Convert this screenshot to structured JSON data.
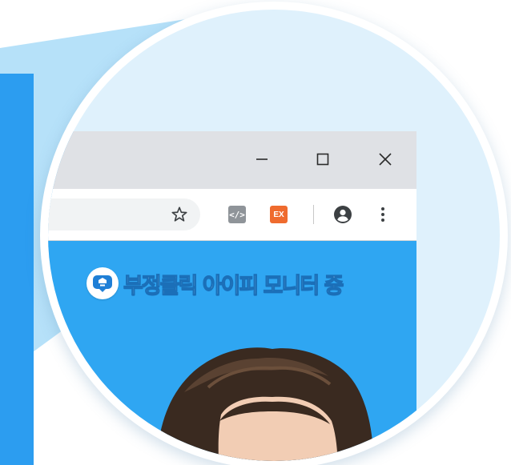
{
  "window_controls": {
    "minimize_icon": "minimize-icon",
    "maximize_icon": "maximize-icon",
    "close_icon": "close-icon"
  },
  "toolbar": {
    "bookmark_icon": "star-outline-icon",
    "extensions": [
      {
        "name": "code-extension",
        "label": "</>",
        "color": "#8f9499"
      },
      {
        "name": "ex-extension",
        "label": "EX",
        "color": "#ef6b2e"
      }
    ],
    "profile_icon": "account-circle-icon",
    "menu_icon": "vertical-dots-icon"
  },
  "page": {
    "badge_text": "부정클릭 아이피 모니터 중",
    "background_color": "#2fa6f2"
  },
  "colors": {
    "magnifier_bg": "#dff1fc",
    "titlebar": "#dfe1e5",
    "left_panel": "#2c9df0"
  }
}
